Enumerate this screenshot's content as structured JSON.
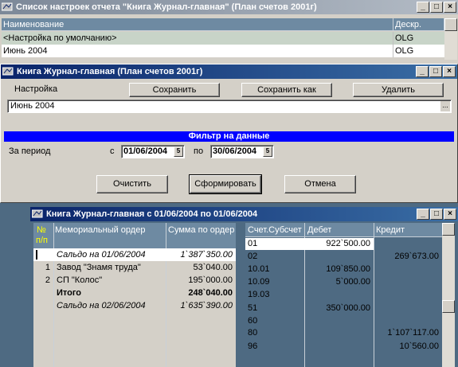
{
  "win1": {
    "title": "Список настроек отчета \"Книга Журнал-главная\" (План счетов 2001г)",
    "col_name": "Наименование",
    "col_desc": "Дескр.",
    "rows": [
      {
        "name": "<Настройка по умолчанию>",
        "desc": "OLG"
      },
      {
        "name": "Июнь 2004",
        "desc": "OLG"
      }
    ]
  },
  "win2": {
    "title": "Книга Журнал-главная (План счетов 2001г)",
    "setting_label": "Настройка",
    "save_label": "Сохранить",
    "save_as_label": "Сохранить как",
    "delete_label": "Удалить",
    "setting_value": "Июнь 2004",
    "ellipsis": "...",
    "filter_header": "Фильтр на данные",
    "period_label": "За период",
    "from_label": "с",
    "from_date": "01/06/2004",
    "to_label": "по",
    "to_date": "30/06/2004",
    "cal_num": "5",
    "clear_label": "Очистить",
    "generate_label": "Сформировать",
    "cancel_label": "Отмена"
  },
  "win3": {
    "title": "Книга Журнал-главная с 01/06/2004 по 01/06/2004",
    "left_headers": {
      "num": "№",
      "num2": "п/п",
      "memo": "Мемориальный ордер",
      "sum": "Сумма по ордер"
    },
    "left_rows": [
      {
        "num": "",
        "memo": "Сальдо на 01/06/2004",
        "sum": "1`387`350.00",
        "style": "it"
      },
      {
        "num": "1",
        "memo": "Завод \"Знамя труда\"",
        "sum": "53`040.00",
        "style": ""
      },
      {
        "num": "2",
        "memo": "СП \"Колос\"",
        "sum": "195`000.00",
        "style": ""
      },
      {
        "num": "",
        "memo": "Итого",
        "sum": "248`040.00",
        "style": "b"
      },
      {
        "num": "",
        "memo": "Сальдо на 02/06/2004",
        "sum": "1`635`390.00",
        "style": "it"
      }
    ],
    "right_headers": {
      "acct": "Счет.Субсчет",
      "debit": "Дебет",
      "credit": "Кредит"
    },
    "right_rows": [
      {
        "acct": "01",
        "debit": "922`500.00",
        "credit": ""
      },
      {
        "acct": "02",
        "debit": "",
        "credit": "269`673.00"
      },
      {
        "acct": "10.01",
        "debit": "109`850.00",
        "credit": ""
      },
      {
        "acct": "10.09",
        "debit": "5`000.00",
        "credit": ""
      },
      {
        "acct": "19.03",
        "debit": "",
        "credit": ""
      },
      {
        "acct": "51",
        "debit": "350`000.00",
        "credit": ""
      },
      {
        "acct": "60",
        "debit": "",
        "credit": ""
      },
      {
        "acct": "80",
        "debit": "",
        "credit": "1`107`117.00"
      },
      {
        "acct": "96",
        "debit": "",
        "credit": "10`560.00"
      }
    ]
  },
  "colors": {
    "titlebar_active": "#0a246a",
    "filter_bar": "#0000ff",
    "grid_bg": "#4e6a82"
  }
}
